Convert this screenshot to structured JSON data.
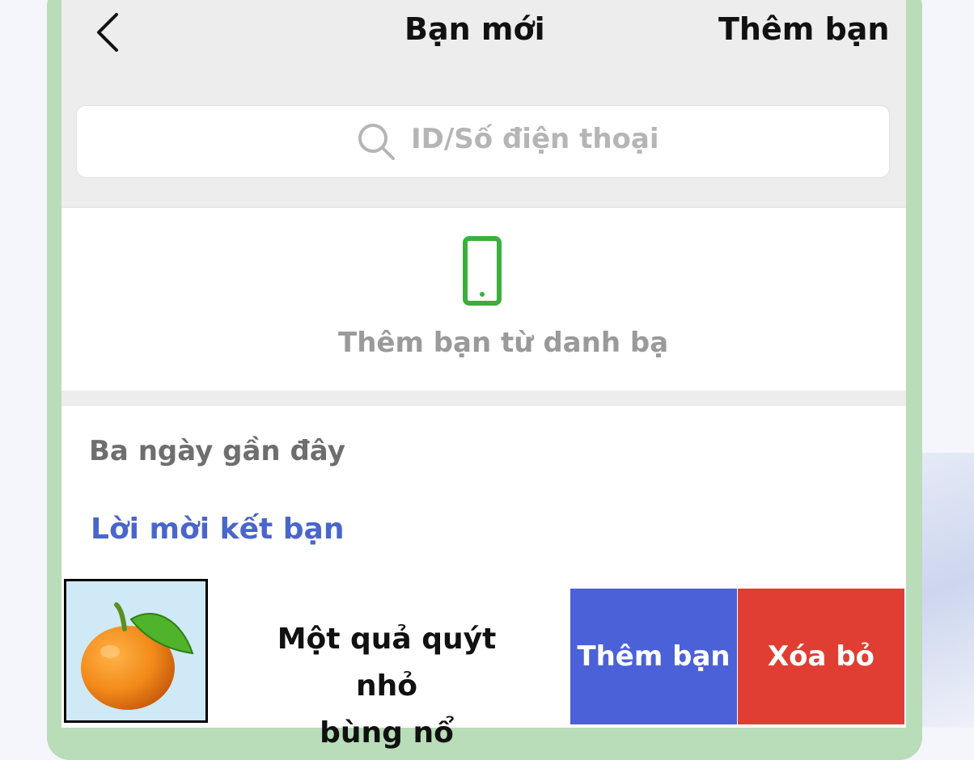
{
  "header": {
    "back_icon": "chevron-left-icon",
    "title": "Bạn mới",
    "action": "Thêm bạn"
  },
  "search": {
    "icon": "search-icon",
    "placeholder": "ID/Số điện thoại"
  },
  "contacts": {
    "icon": "smartphone-icon",
    "label": "Thêm bạn từ danh bạ",
    "icon_color": "#3dae3d"
  },
  "recent": {
    "section_label": "Ba ngày gần đây",
    "invites_label": "Lời mời kết bạn",
    "invite": {
      "avatar_icon": "orange-icon",
      "name_line1": "Một quả quýt nhỏ",
      "name_line2": "bùng nổ",
      "accept_label": "Thêm bạn",
      "reject_label": "Xóa bỏ"
    }
  },
  "colors": {
    "accent_blue": "#4b61d8",
    "danger_red": "#e03e33",
    "link_blue": "#4a66cc",
    "frame_green": "#b9dcb9"
  }
}
